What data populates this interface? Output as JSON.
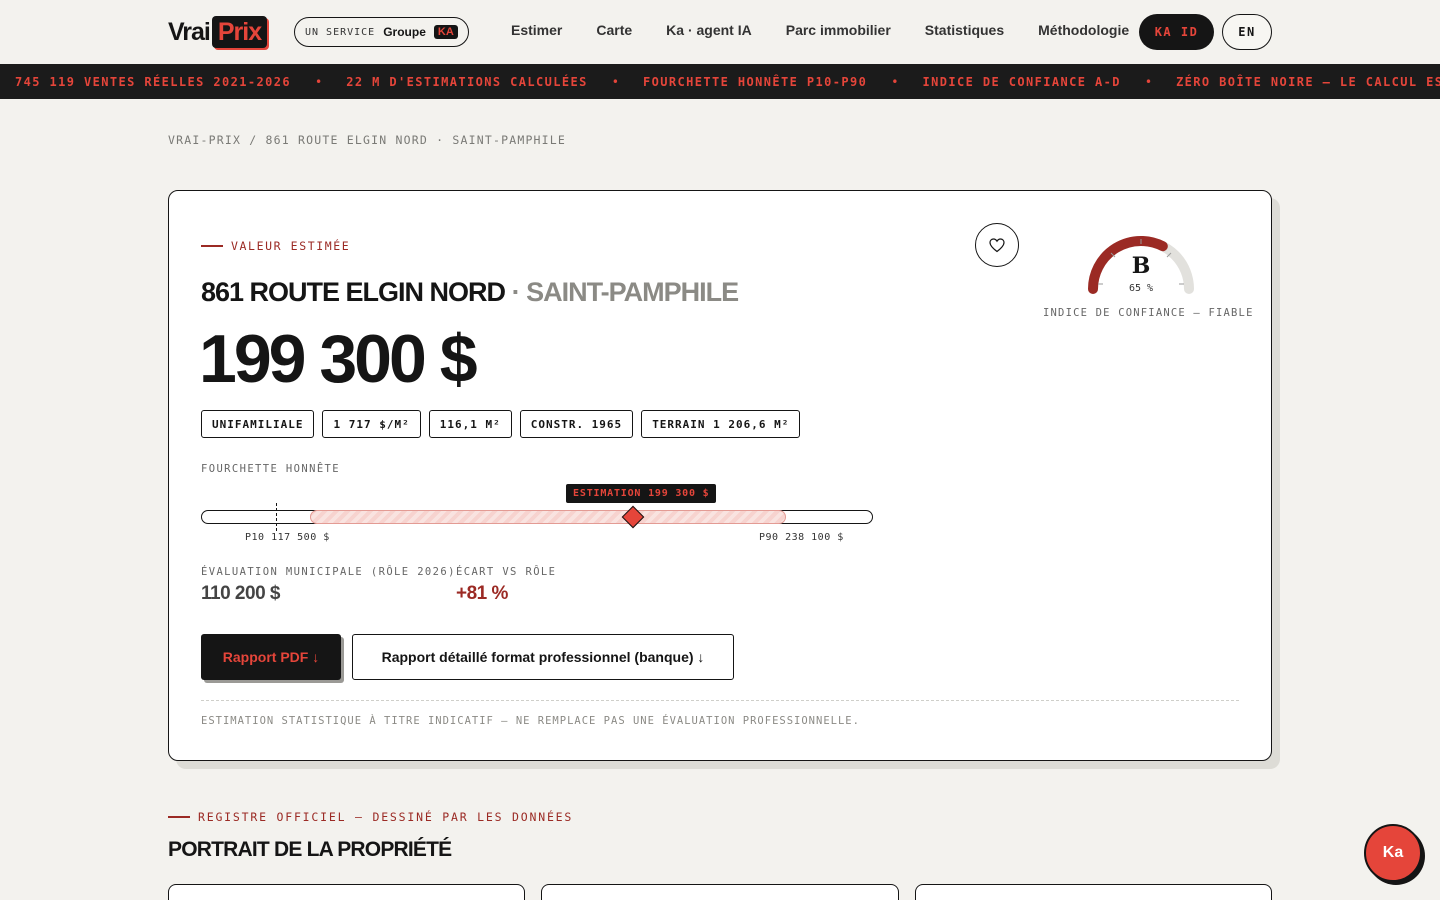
{
  "brand": {
    "vrai": "Vrai",
    "prix": "Prix"
  },
  "service": {
    "label": "UN SERVICE",
    "groupe": "Groupe",
    "ka": "KA"
  },
  "nav": [
    "Estimer",
    "Carte",
    "Ka · agent IA",
    "Parc immobilier",
    "Statistiques",
    "Méthodologie"
  ],
  "header_buttons": {
    "kaid": "KA ID",
    "lang": "EN"
  },
  "ticker": [
    "745 119 VENTES RÉELLES 2021-2026",
    "22 M D'ESTIMATIONS CALCULÉES",
    "FOURCHETTE HONNÊTE P10-P90",
    "INDICE DE CONFIANCE A-D",
    "ZÉRO BOÎTE NOIRE — LE CALCUL EST MONTRÉ"
  ],
  "breadcrumb": "VRAI-PRIX / 861 ROUTE ELGIN NORD · SAINT-PAMPHILE",
  "estimate": {
    "eyebrow": "VALEUR ESTIMÉE",
    "address": "861 ROUTE ELGIN NORD",
    "city": "· SAINT-PAMPHILE",
    "price": "199 300 $",
    "chips": [
      "UNIFAMILIALE",
      "1 717 $/M²",
      "116,1 M²",
      "CONSTR. 1965",
      "TERRAIN 1 206,6 M²"
    ],
    "range_label": "FOURCHETTE HONNÊTE",
    "range": {
      "p10": 117500,
      "p90": 238100,
      "estimate": 199300,
      "axis_min": 90000,
      "axis_max": 260000
    },
    "estimate_tag": "ESTIMATION 199 300 $",
    "p10_label": "P10 117 500 $",
    "p90_label": "P90 238 100 $",
    "municipal_label": "ÉVALUATION MUNICIPALE (RÔLE 2026)",
    "municipal_value": "110 200 $",
    "gap_label": "ÉCART VS RÔLE",
    "gap_value": "+81 %",
    "btn_pdf": "Rapport PDF ↓",
    "btn_report": "Rapport détaillé format professionnel (banque) ↓",
    "disclaimer": "ESTIMATION STATISTIQUE À TITRE INDICATIF — NE REMPLACE PAS UNE ÉVALUATION PROFESSIONNELLE.",
    "confidence": {
      "grade": "B",
      "percent_text": "65 %",
      "percent": 0.65,
      "caption": "INDICE DE CONFIANCE — FIABLE"
    }
  },
  "section": {
    "eyebrow": "REGISTRE OFFICIEL — DESSINÉ PAR LES DONNÉES",
    "title": "PORTRAIT DE LA PROPRIÉTÉ"
  },
  "chat_button": "Ka",
  "colors": {
    "accent": "#e5453a",
    "dark": "#151515",
    "maroon": "#9b2a24",
    "bg": "#f3f2ee"
  }
}
